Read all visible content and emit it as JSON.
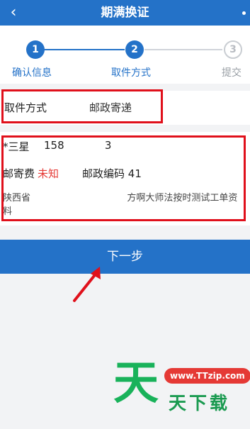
{
  "header": {
    "back_icon": "‹",
    "title": "期满换证"
  },
  "steps": [
    {
      "number": "1",
      "label": "确认信息",
      "state": "done"
    },
    {
      "number": "2",
      "label": "取件方式",
      "state": "active"
    },
    {
      "number": "3",
      "label": "提交",
      "state": "pending"
    }
  ],
  "pickup": {
    "label": "取件方式",
    "value": "邮政寄递"
  },
  "address": {
    "name": "*三星",
    "phone": "158            3",
    "fee_label": "邮寄费",
    "fee_value": "未知",
    "zip_label": "邮政编码",
    "zip_value": "41",
    "detail": "陕西省                                 方啊大师法按时测试工单资料"
  },
  "next_button": {
    "label": "下一步"
  },
  "watermark": {
    "big": "天",
    "url": "www.TTzip.com",
    "text": "天下载"
  },
  "colors": {
    "primary": "#2472c8",
    "annotation_red": "#e0101b",
    "fee_red": "#e53935",
    "logo_green": "#19b25a"
  }
}
